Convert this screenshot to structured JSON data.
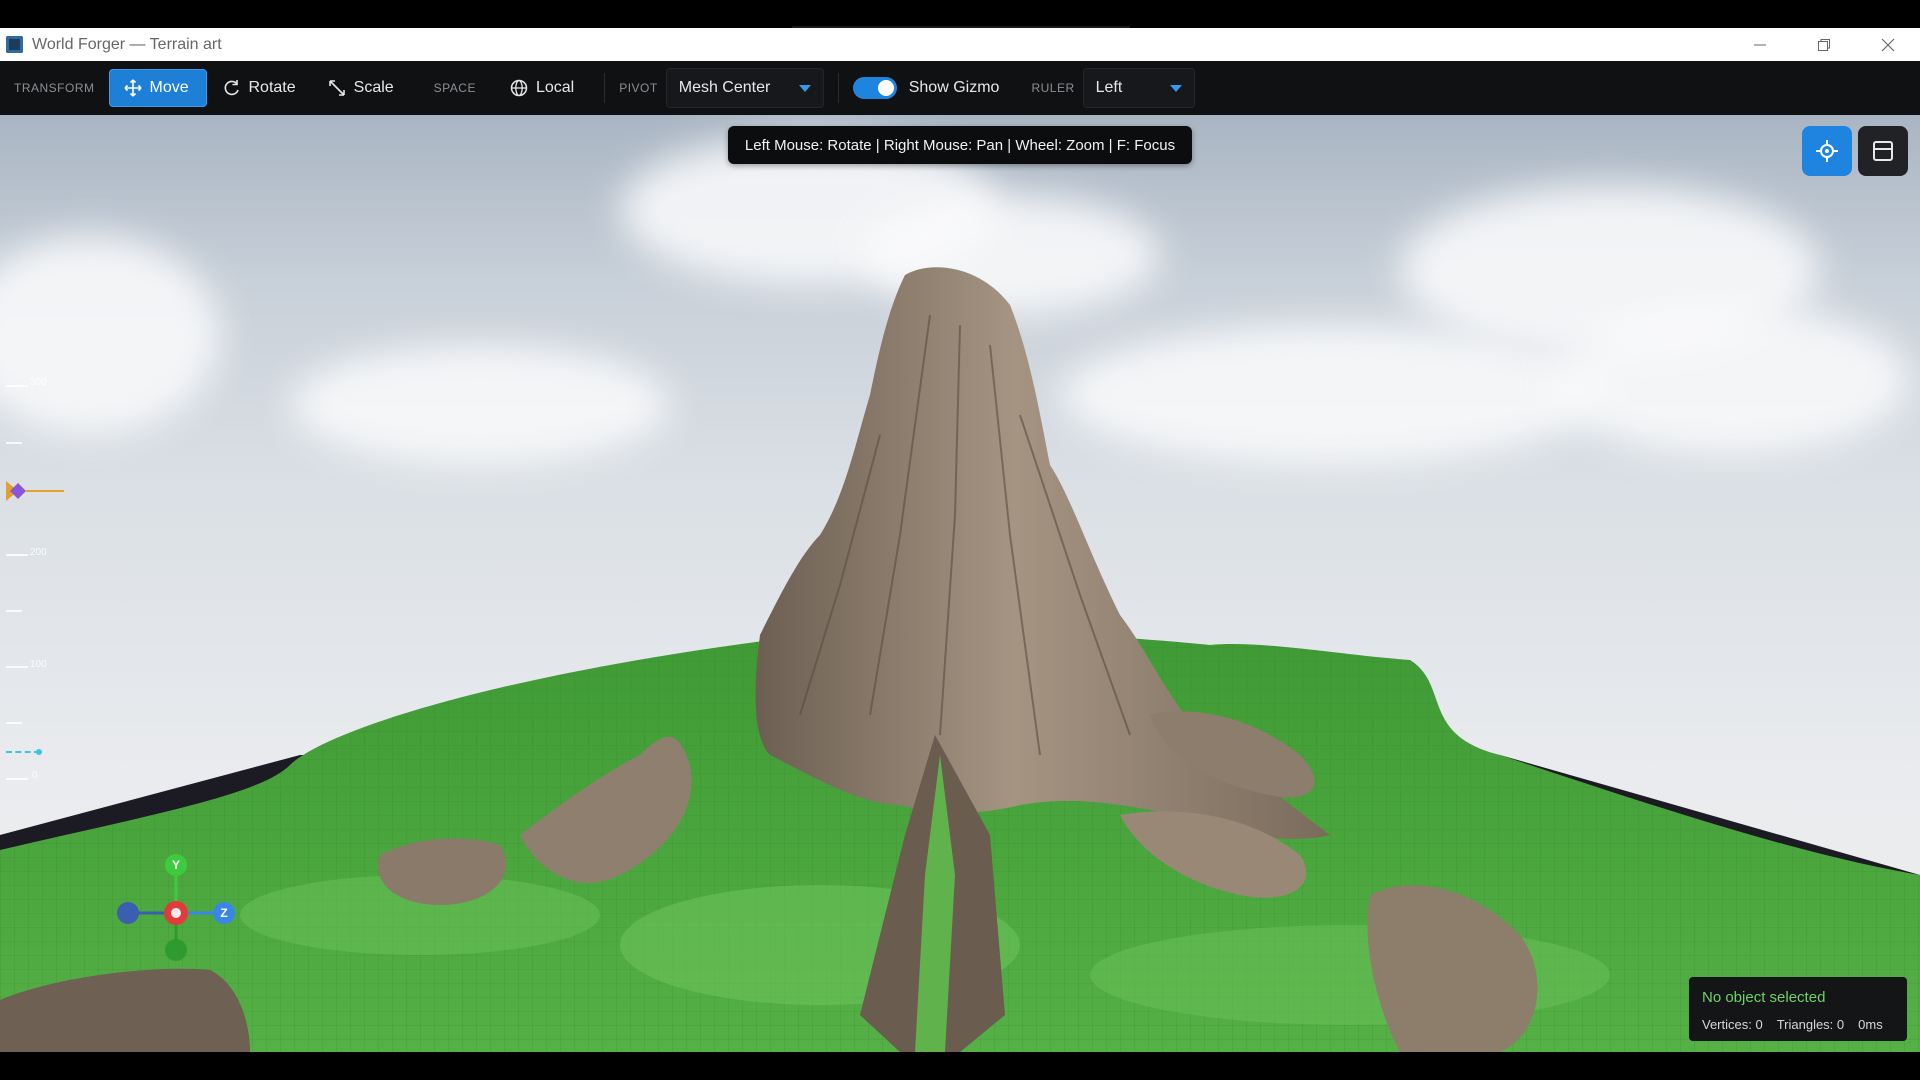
{
  "window": {
    "title": "World Forger — Terrain art",
    "controls": [
      "minimize",
      "restore",
      "close"
    ]
  },
  "toolbar": {
    "transform_label": "TRANSFORM",
    "move_label": "Move",
    "rotate_label": "Rotate",
    "scale_label": "Scale",
    "space_label": "SPACE",
    "local_label": "Local",
    "pivot_label": "PIVOT",
    "pivot_value": "Mesh Center",
    "show_gizmo_label": "Show Gizmo",
    "show_gizmo_on": true,
    "ruler_label": "RULER",
    "ruler_value": "Left",
    "accent_color": "#1d7fd6"
  },
  "viewport": {
    "hint": "Left Mouse: Rotate | Right Mouse: Pan | Wheel: Zoom | F: Focus",
    "ruler_ticks": [
      "300",
      "200",
      "100",
      "0"
    ],
    "gizmo_axes": {
      "y": "Y",
      "z": "Z"
    },
    "axis_colors": {
      "x": "#e23b3b",
      "y": "#3fcb3f",
      "z": "#3a86e8"
    },
    "terrain_colors": {
      "grass": "#4fa33a",
      "rock": "#8a7a6a"
    },
    "icons": {
      "focus": "crosshair-icon",
      "layout": "panel-layout-icon"
    }
  },
  "status": {
    "selection": "No object selected",
    "vertices": "Vertices: 0",
    "triangles": "Triangles: 0",
    "time": "0ms",
    "selection_color": "#6fd36a"
  }
}
